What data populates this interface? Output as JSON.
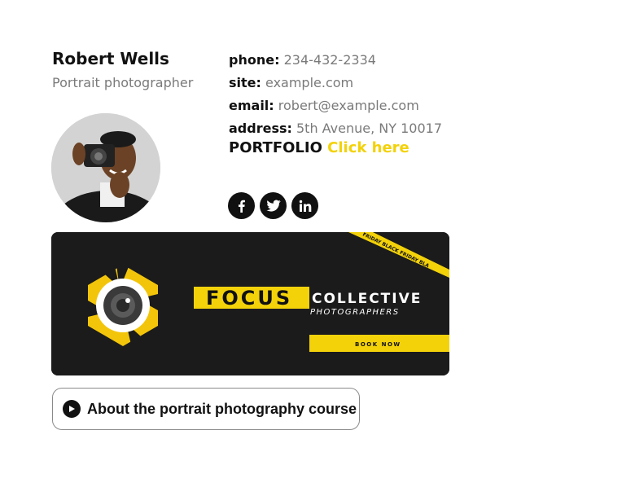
{
  "profile": {
    "name": "Robert Wells",
    "title": "Portrait photographer"
  },
  "contact": {
    "phone_label": "phone:",
    "phone": "234-432-2334",
    "site_label": "site:",
    "site": "example.com",
    "email_label": "email:",
    "email": "robert@example.com",
    "address_label": "address:",
    "address": "5th Avenue, NY 10017"
  },
  "portfolio": {
    "label": "PORTFOLIO",
    "link_text": "Click here"
  },
  "social_icons": [
    "facebook-icon",
    "twitter-icon",
    "linkedin-icon"
  ],
  "banner": {
    "brand": "FOCUS",
    "brand_suffix": "COLLECTIVE",
    "subtitle": "PHOTOGRAPHERS",
    "button": "BOOK NOW",
    "ribbon": "FRIDAY   BLACK FRIDAY   BLA"
  },
  "course_button": {
    "label": "About the portrait photography course"
  },
  "colors": {
    "accent": "#f3d20a",
    "muted_text": "#7a7a7a",
    "dark": "#111111"
  }
}
